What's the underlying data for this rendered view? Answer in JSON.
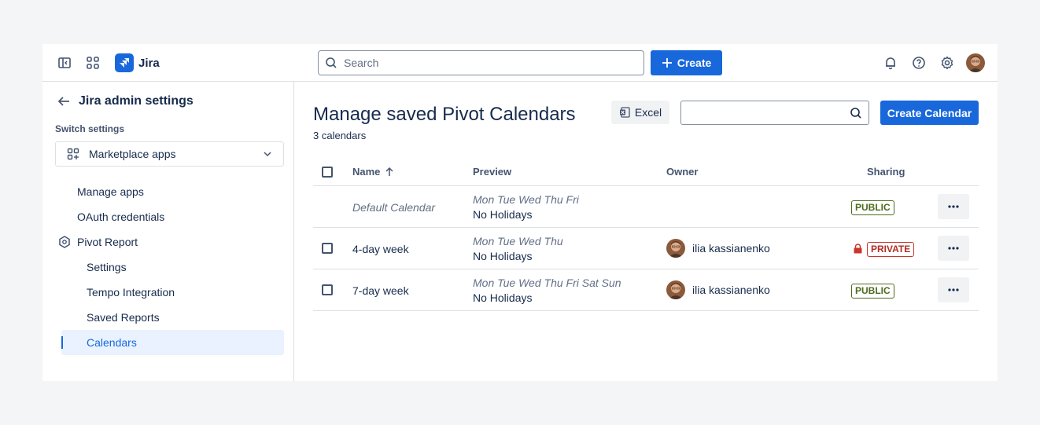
{
  "app": {
    "name": "Jira"
  },
  "topbar": {
    "search_placeholder": "Search",
    "create_label": "Create",
    "icons": [
      "sidebar-toggle-icon",
      "app-switcher-icon",
      "notifications-icon",
      "help-icon",
      "settings-icon"
    ]
  },
  "sidebar": {
    "back_title": "Jira admin settings",
    "switch_label": "Switch settings",
    "switch_value": "Marketplace apps",
    "items": [
      {
        "label": "Manage apps"
      },
      {
        "label": "OAuth credentials"
      },
      {
        "label": "Pivot Report"
      },
      {
        "label": "Settings"
      },
      {
        "label": "Tempo Integration"
      },
      {
        "label": "Saved Reports"
      },
      {
        "label": "Calendars",
        "active": true
      }
    ]
  },
  "main": {
    "title": "Manage saved Pivot Calendars",
    "subtitle": "3 calendars",
    "excel_label": "Excel",
    "search_value": "",
    "create_calendar_label": "Create Calendar",
    "columns": {
      "name": "Name",
      "preview": "Preview",
      "owner": "Owner",
      "sharing": "Sharing"
    },
    "rows": [
      {
        "name": "Default Calendar",
        "days": "Mon Tue Wed Thu Fri",
        "holidays": "No Holidays",
        "owner": "",
        "sharing": "PUBLIC",
        "default": true
      },
      {
        "name": "4-day week",
        "days": "Mon Tue Wed Thu",
        "holidays": "No Holidays",
        "owner": "ilia kassianenko",
        "sharing": "PRIVATE"
      },
      {
        "name": "7-day week",
        "days": "Mon Tue Wed Thu Fri Sat Sun",
        "holidays": "No Holidays",
        "owner": "ilia kassianenko",
        "sharing": "PUBLIC"
      }
    ]
  },
  "colors": {
    "brand": "#1868db",
    "public": "#4c6b1f",
    "private": "#c9372c"
  }
}
